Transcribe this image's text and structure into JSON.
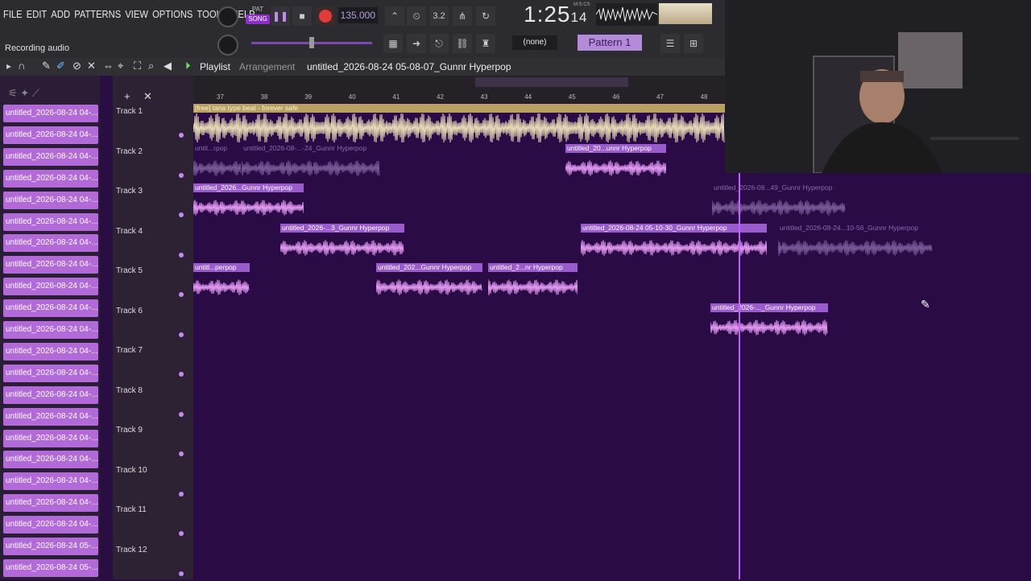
{
  "menu": [
    "FILE",
    "EDIT",
    "ADD",
    "PATTERNS",
    "VIEW",
    "OPTIONS",
    "TOOLS",
    "HELP"
  ],
  "transport": {
    "pat": "PAT",
    "song": "SONG",
    "tempo": "135.000",
    "time_main": "1:25",
    "time_ticks": "14",
    "time_label": "M:S:CS"
  },
  "hint": "Recording audio",
  "toolbar": {
    "none_label": "(none)",
    "pattern": "Pattern 1"
  },
  "playlist": {
    "title": "Playlist",
    "mode": "Arrangement",
    "project": "untitled_2026-08-24 05-08-07_Gunnr Hyperpop"
  },
  "sidebar_items": [
    "untitled_2026-08-24 04-...",
    "untitled_2026-08-24 04-...",
    "untitled_2026-08-24 04-...",
    "untitled_2026-08-24 04-...",
    "untitled_2026-08-24 04-...",
    "untitled_2026-08-24 04-...",
    "untitled_2026-08-24 04-...",
    "untitled_2026-08-24 04-...",
    "untitled_2026-08-24 04-...",
    "untitled_2026-08-24 04-...",
    "untitled_2026-08-24 04-...",
    "untitled_2026-08-24 04-...",
    "untitled_2026-08-24 04-...",
    "untitled_2026-08-24 04-...",
    "untitled_2026-08-24 04-...",
    "untitled_2026-08-24 04-...",
    "untitled_2026-08-24 04-...",
    "untitled_2026-08-24 04-...",
    "untitled_2026-08-24 04-...",
    "untitled_2026-08-24 04-...",
    "untitled_2026-08-24 05-...",
    "untitled_2026-08-24 05-..."
  ],
  "ruler": [
    "37",
    "38",
    "39",
    "40",
    "41",
    "42",
    "43",
    "44",
    "45",
    "46",
    "47",
    "48"
  ],
  "tracks": [
    "Track 1",
    "Track 2",
    "Track 3",
    "Track 4",
    "Track 5",
    "Track 6",
    "Track 7",
    "Track 8",
    "Track 9",
    "Track 10",
    "Track 11",
    "Track 12"
  ],
  "clips": [
    {
      "label": "[free] tana type beat - forever safe",
      "track": 0,
      "start": 0,
      "end": 660,
      "ghost": false,
      "gold": true
    },
    {
      "label": "untit...rpop",
      "track": 1,
      "start": 0,
      "end": 60,
      "ghost": true
    },
    {
      "label": "untitled_2026-08-...-24_Gunnr Hyperpop",
      "track": 1,
      "start": 60,
      "end": 232,
      "ghost": true
    },
    {
      "label": "untitled_20...unnr Hyperpop",
      "track": 1,
      "start": 462,
      "end": 587,
      "ghost": false
    },
    {
      "label": "untitled_2026...Gunnr Hyperpop",
      "track": 2,
      "start": 0,
      "end": 137,
      "ghost": false
    },
    {
      "label": "untitled_2026-08...49_Gunnr Hyperpop",
      "track": 2,
      "start": 644,
      "end": 810,
      "ghost": true
    },
    {
      "label": "untitled_2026-...3_Gunnr Hyperpop",
      "track": 3,
      "start": 108,
      "end": 262,
      "ghost": false
    },
    {
      "label": "untitled_2026-08-24 05-10-30_Gunnr Hyperpop",
      "track": 3,
      "start": 481,
      "end": 712,
      "ghost": false
    },
    {
      "label": "untitled_2026-08-24...10-56_Gunnr Hyperpop",
      "track": 3,
      "start": 726,
      "end": 918,
      "ghost": true
    },
    {
      "label": "untitl...perpop",
      "track": 4,
      "start": 0,
      "end": 70,
      "ghost": false
    },
    {
      "label": "untitled_202...Gunnr Hyperpop",
      "track": 4,
      "start": 227,
      "end": 359,
      "ghost": false
    },
    {
      "label": "untitled_2...nr Hyperpop",
      "track": 4,
      "start": 366,
      "end": 477,
      "ghost": false
    },
    {
      "label": "untitled_2026-..._Gunnr Hyperpop",
      "track": 5,
      "start": 642,
      "end": 788,
      "ghost": false
    }
  ]
}
